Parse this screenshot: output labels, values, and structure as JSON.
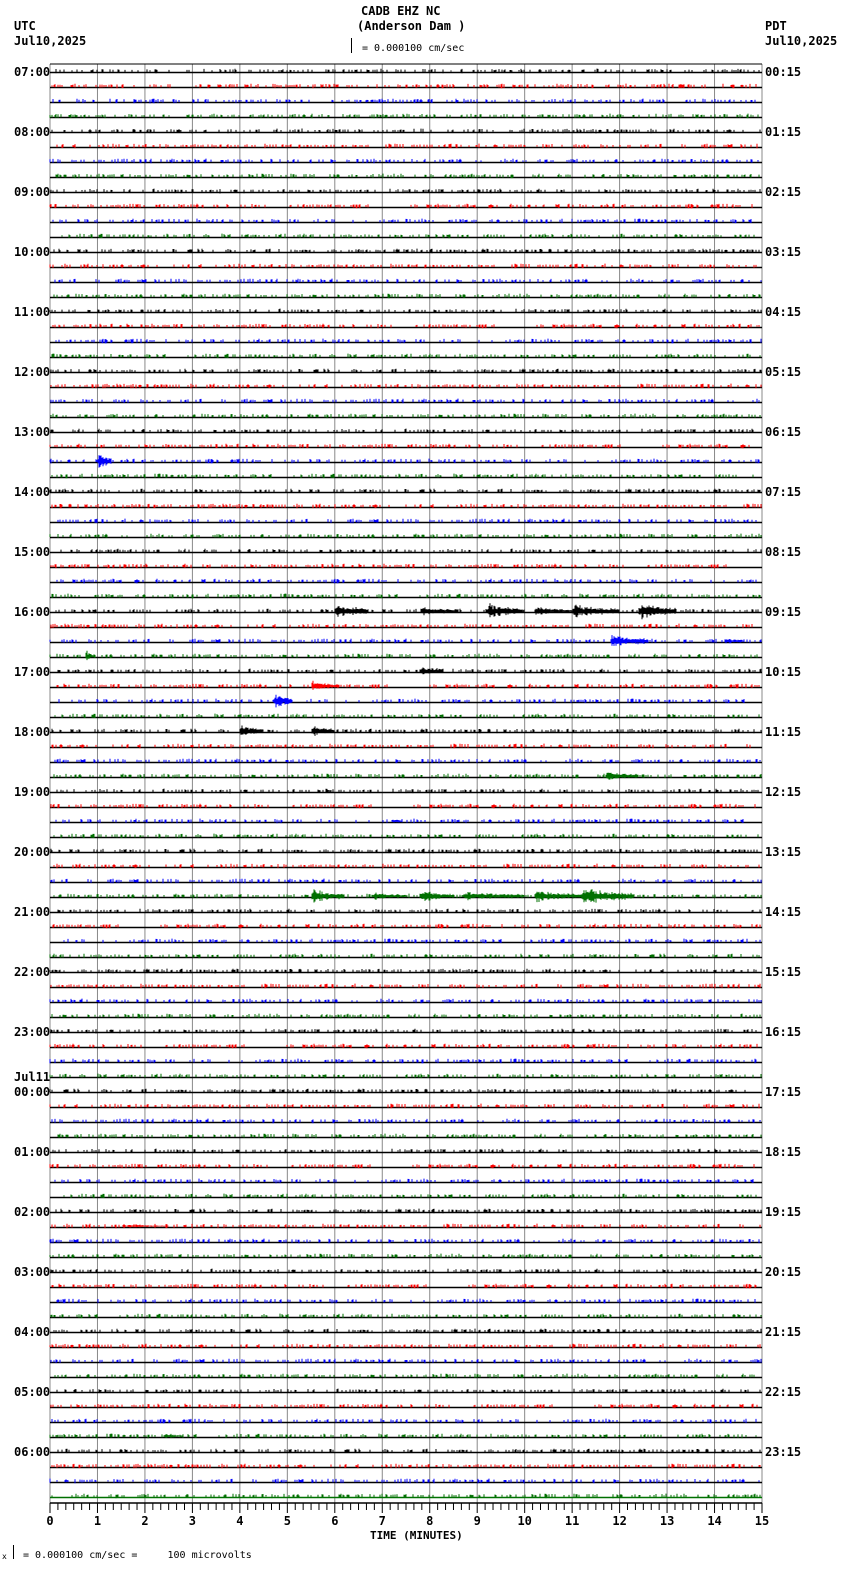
{
  "header": {
    "station": "CADB EHZ NC",
    "location": "(Anderson Dam )",
    "scale_label": "= 0.000100 cm/sec",
    "left_tz": "UTC",
    "left_date": "Jul10,2025",
    "right_tz": "PDT",
    "right_date": "Jul10,2025"
  },
  "footer": {
    "scale_note": "= 0.000100 cm/sec =     100 microvolts",
    "marker": "x"
  },
  "chart_data": {
    "type": "line",
    "title": "CADB EHZ NC (Anderson Dam )",
    "xlabel": "TIME (MINUTES)",
    "xlim": [
      0,
      15
    ],
    "x_ticks": [
      "0",
      "1",
      "2",
      "3",
      "4",
      "5",
      "6",
      "7",
      "8",
      "9",
      "10",
      "11",
      "12",
      "13",
      "14",
      "15"
    ],
    "traces_per_hour": 4,
    "trace_count": 96,
    "trace_colors": [
      "#000000",
      "#ff0000",
      "#0000ff",
      "#007000"
    ],
    "left_labels": [
      {
        "trace": 0,
        "text": "07:00"
      },
      {
        "trace": 4,
        "text": "08:00"
      },
      {
        "trace": 8,
        "text": "09:00"
      },
      {
        "trace": 12,
        "text": "10:00"
      },
      {
        "trace": 16,
        "text": "11:00"
      },
      {
        "trace": 20,
        "text": "12:00"
      },
      {
        "trace": 24,
        "text": "13:00"
      },
      {
        "trace": 28,
        "text": "14:00"
      },
      {
        "trace": 32,
        "text": "15:00"
      },
      {
        "trace": 36,
        "text": "16:00"
      },
      {
        "trace": 40,
        "text": "17:00"
      },
      {
        "trace": 44,
        "text": "18:00"
      },
      {
        "trace": 48,
        "text": "19:00"
      },
      {
        "trace": 52,
        "text": "20:00"
      },
      {
        "trace": 56,
        "text": "21:00"
      },
      {
        "trace": 60,
        "text": "22:00"
      },
      {
        "trace": 64,
        "text": "23:00"
      },
      {
        "trace": 68,
        "text": "00:00",
        "date": "Jul11"
      },
      {
        "trace": 72,
        "text": "01:00"
      },
      {
        "trace": 76,
        "text": "02:00"
      },
      {
        "trace": 80,
        "text": "03:00"
      },
      {
        "trace": 84,
        "text": "04:00"
      },
      {
        "trace": 88,
        "text": "05:00"
      },
      {
        "trace": 92,
        "text": "06:00"
      }
    ],
    "right_labels": [
      "00:15",
      "01:15",
      "02:15",
      "03:15",
      "04:15",
      "05:15",
      "06:15",
      "07:15",
      "08:15",
      "09:15",
      "10:15",
      "11:15",
      "12:15",
      "13:15",
      "14:15",
      "15:15",
      "16:15",
      "17:15",
      "18:15",
      "19:15",
      "20:15",
      "21:15",
      "22:15",
      "23:15"
    ],
    "events": [
      {
        "trace": 26,
        "start": 1.0,
        "end": 1.3,
        "amp": 12
      },
      {
        "trace": 36,
        "start": 6.0,
        "end": 6.7,
        "amp": 10
      },
      {
        "trace": 36,
        "start": 7.8,
        "end": 8.6,
        "amp": 6
      },
      {
        "trace": 36,
        "start": 9.2,
        "end": 10.0,
        "amp": 10
      },
      {
        "trace": 36,
        "start": 10.2,
        "end": 11.0,
        "amp": 6
      },
      {
        "trace": 36,
        "start": 11.0,
        "end": 12.0,
        "amp": 9
      },
      {
        "trace": 36,
        "start": 12.4,
        "end": 13.2,
        "amp": 12
      },
      {
        "trace": 38,
        "start": 11.8,
        "end": 12.6,
        "amp": 9
      },
      {
        "trace": 38,
        "start": 14.2,
        "end": 14.6,
        "amp": 4
      },
      {
        "trace": 39,
        "start": 0.75,
        "end": 0.95,
        "amp": 8
      },
      {
        "trace": 40,
        "start": 7.8,
        "end": 8.3,
        "amp": 8
      },
      {
        "trace": 41,
        "start": 5.5,
        "end": 6.1,
        "amp": 7
      },
      {
        "trace": 42,
        "start": 4.7,
        "end": 5.1,
        "amp": 12
      },
      {
        "trace": 44,
        "start": 4.0,
        "end": 4.5,
        "amp": 8
      },
      {
        "trace": 44,
        "start": 5.5,
        "end": 6.0,
        "amp": 8
      },
      {
        "trace": 47,
        "start": 11.7,
        "end": 12.4,
        "amp": 6
      },
      {
        "trace": 48,
        "start": 5.8,
        "end": 5.9,
        "amp": 5
      },
      {
        "trace": 50,
        "start": 7.2,
        "end": 7.4,
        "amp": 4
      },
      {
        "trace": 55,
        "start": 5.5,
        "end": 6.2,
        "amp": 10
      },
      {
        "trace": 55,
        "start": 6.8,
        "end": 7.5,
        "amp": 5
      },
      {
        "trace": 55,
        "start": 7.8,
        "end": 8.5,
        "amp": 8
      },
      {
        "trace": 55,
        "start": 8.7,
        "end": 10.0,
        "amp": 6
      },
      {
        "trace": 55,
        "start": 10.2,
        "end": 11.2,
        "amp": 9
      },
      {
        "trace": 55,
        "start": 11.2,
        "end": 12.3,
        "amp": 12
      },
      {
        "trace": 77,
        "start": 1.6,
        "end": 2.5,
        "amp": 2
      },
      {
        "trace": 91,
        "start": 2.4,
        "end": 2.8,
        "amp": 3
      }
    ]
  }
}
